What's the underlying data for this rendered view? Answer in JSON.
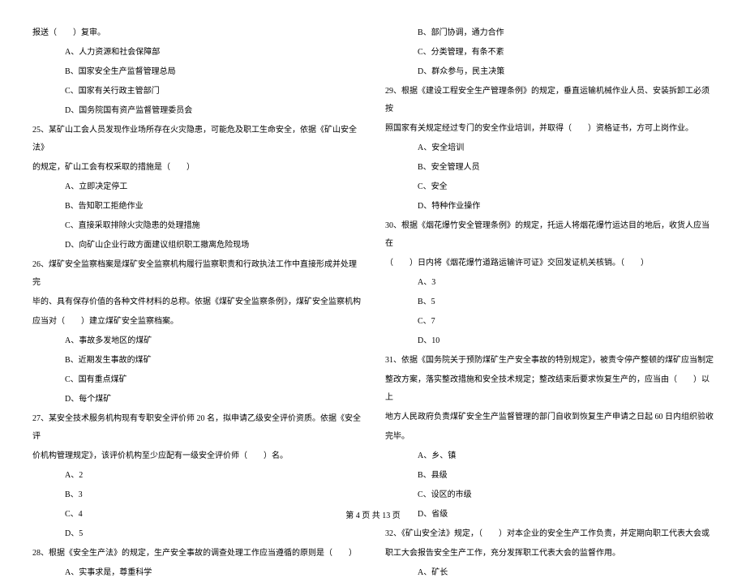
{
  "left": {
    "l0": "报送（　　）复审。",
    "l0a": "A、人力资源和社会保障部",
    "l0b": "B、国家安全生产监督管理总局",
    "l0c": "C、国家有关行政主管部门",
    "l0d": "D、国务院国有资产监督管理委员会",
    "q25": "25、某矿山工会人员发现作业场所存在火灾隐患，可能危及职工生命安全，依据《矿山安全法》",
    "q25b": "的规定，矿山工会有权采取的措施是（　　）",
    "q25oa": "A、立即决定停工",
    "q25ob": "B、告知职工拒绝作业",
    "q25oc": "C、直接采取排除火灾隐患的处理措施",
    "q25od": "D、向矿山企业行政方面建议组织职工撤离危险现场",
    "q26": "26、煤矿安全监察档案是煤矿安全监察机构履行监察职责和行政执法工作中直接形成并处理完",
    "q26b": "毕的、具有保存价值的各种文件材料的总称。依据《煤矿安全监察条例》，煤矿安全监察机构",
    "q26c": "应当对（　　）建立煤矿安全监察档案。",
    "q26oa": "A、事故多发地区的煤矿",
    "q26ob": "B、近期发生事故的煤矿",
    "q26oc": "C、国有重点煤矿",
    "q26od": "D、每个煤矿",
    "q27": "27、某安全技术服务机构现有专职安全评价师 20 名，拟申请乙级安全评价资质。依据《安全评",
    "q27b": "价机构管理规定》，该评价机构至少应配有一级安全评价师（　　）名。",
    "q27oa": "A、2",
    "q27ob": "B、3",
    "q27oc": "C、4",
    "q27od": "D、5",
    "q28": "28、根据《安全生产法》的规定，生产安全事故的调查处理工作应当遵循的原则是（　　）",
    "q28oa": "A、实事求是，尊重科学"
  },
  "right": {
    "q28ob": "B、部门协调，通力合作",
    "q28oc": "C、分类管理，有条不紊",
    "q28od": "D、群众参与，民主决策",
    "q29": "29、根据《建设工程安全生产管理条例》的规定，垂直运输机械作业人员、安装拆卸工必须按",
    "q29b": "照国家有关规定经过专门的安全作业培训，并取得（　　）资格证书，方可上岗作业。",
    "q29oa": "A、安全培训",
    "q29ob": "B、安全管理人员",
    "q29oc": "C、安全",
    "q29od": "D、特种作业操作",
    "q30": "30、根据《烟花爆竹安全管理条例》的规定，托运人将烟花爆竹运达目的地后，收货人应当在",
    "q30b": "（　　）日内将《烟花爆竹道路运输许可证》交回发证机关核销。（　　）",
    "q30oa": "A、3",
    "q30ob": "B、5",
    "q30oc": "C、7",
    "q30od": "D、10",
    "q31": "31、依据《国务院关于预防煤矿生产安全事故的特别规定》，被责令停产整顿的煤矿应当制定",
    "q31b": "整改方案，落实整改措施和安全技术规定；整改结束后要求恢复生产的，应当由（　　）以上",
    "q31c": "地方人民政府负责煤矿安全生产监督管理的部门自收到恢复生产申请之日起 60 日内组织验收",
    "q31d": "完毕。",
    "q31oa": "A、乡、镇",
    "q31ob": "B、县级",
    "q31oc": "C、设区的市级",
    "q31od": "D、省级",
    "q32": "32、《矿山安全法》规定，（　　）对本企业的安全生产工作负责，并定期向职工代表大会或",
    "q32b": "职工大会报告安全生产工作，充分发挥职工代表大会的监督作用。",
    "q32oa": "A、矿长"
  },
  "footer": "第 4 页 共 13 页"
}
